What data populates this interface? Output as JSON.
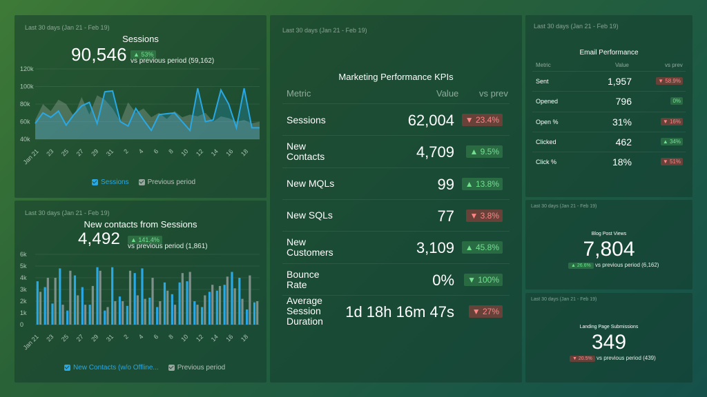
{
  "colors": {
    "accent": "#29a8e6",
    "previous": "#9aa9a0",
    "up": "#6fe08e",
    "down": "#ff8a8a"
  },
  "sessions": {
    "period": "Last 30 days (Jan 21 - Feb 19)",
    "title": "Sessions",
    "value": "90,546",
    "change": "▲ 53%",
    "vs_previous": "vs previous period (59,162)",
    "legend": {
      "current": "Sessions",
      "previous": "Previous period"
    }
  },
  "contacts": {
    "period": "Last 30 days (Jan 21 - Feb 19)",
    "title": "New contacts from Sessions",
    "value": "4,492",
    "change": "▲ 141.4%",
    "vs_previous": "vs previous period (1,861)",
    "legend": {
      "current": "New Contacts (w/o Offline...",
      "previous": "Previous period"
    }
  },
  "kpi": {
    "period": "Last 30 days (Jan 21 - Feb 19)",
    "title": "Marketing Performance KPIs",
    "col_metric": "Metric",
    "col_value": "Value",
    "col_vs": "vs prev",
    "rows": [
      {
        "name": "Sessions",
        "value": "62,004",
        "change": "▼ 23.4%",
        "dir": "dn"
      },
      {
        "name": "New\nContacts",
        "value": "4,709",
        "change": "▲ 9.5%",
        "dir": "up"
      },
      {
        "name": "New MQLs",
        "value": "99",
        "change": "▲ 13.8%",
        "dir": "up"
      },
      {
        "name": "New SQLs",
        "value": "77",
        "change": "▼ 3.8%",
        "dir": "dn"
      },
      {
        "name": "New\nCustomers",
        "value": "3,109",
        "change": "▲ 45.8%",
        "dir": "up"
      },
      {
        "name": "Bounce\nRate",
        "value": "0%",
        "change": "▼ 100%",
        "dir": "up"
      },
      {
        "name": "Average\nSession\nDuration",
        "value": "1d 18h 16m 47s",
        "change": "▼ 27%",
        "dir": "dn"
      }
    ]
  },
  "email": {
    "period": "Last 30 days (Jan 21 - Feb 19)",
    "title": "Email Performance",
    "col_metric": "Metric",
    "col_value": "Value",
    "col_vs": "vs prev",
    "rows": [
      {
        "name": "Sent",
        "value": "1,957",
        "change": "▼ 58.9%",
        "dir": "dn"
      },
      {
        "name": "Opened",
        "value": "796",
        "change": "0%",
        "dir": "up"
      },
      {
        "name": "Open %",
        "value": "31%",
        "change": "▼ 16%",
        "dir": "dn"
      },
      {
        "name": "Clicked",
        "value": "462",
        "change": "▲ 34%",
        "dir": "up"
      },
      {
        "name": "Click %",
        "value": "18%",
        "change": "▼ 51%",
        "dir": "dn"
      }
    ]
  },
  "blog": {
    "period": "Last 30 days (Jan 21 - Feb 19)",
    "title": "Blog Post Views",
    "value": "7,804",
    "change": "▲ 26.6%",
    "vs_previous": "vs previous period (6,162)"
  },
  "landing": {
    "period": "Last 30 days (Jan 21 - Feb 19)",
    "title": "Landing Page Submissions",
    "value": "349",
    "change": "▼ 20.5%",
    "vs_previous": "vs previous period (439)"
  },
  "chart_data": [
    {
      "type": "line",
      "title": "Sessions",
      "x": [
        "Jan 21",
        "22",
        "23",
        "24",
        "25",
        "26",
        "27",
        "28",
        "29",
        "30",
        "31",
        "1",
        "2",
        "3",
        "4",
        "5",
        "6",
        "7",
        "8",
        "9",
        "10",
        "11",
        "12",
        "13",
        "14",
        "15",
        "16",
        "17",
        "18",
        "19"
      ],
      "tick_labels": [
        "Jan 21",
        "23",
        "25",
        "27",
        "29",
        "31",
        "2",
        "4",
        "6",
        "8",
        "10",
        "12",
        "14",
        "16",
        "18"
      ],
      "ylim": [
        40000,
        120000
      ],
      "yticks": [
        "40k",
        "60k",
        "80k",
        "100k",
        "120k"
      ],
      "series": [
        {
          "name": "Sessions",
          "values": [
            58000,
            70000,
            65000,
            72000,
            56000,
            68000,
            78000,
            82000,
            58000,
            94000,
            95000,
            60000,
            55000,
            75000,
            62000,
            50000,
            68000,
            69000,
            70000,
            60000,
            50000,
            98000,
            60000,
            62000,
            96000,
            80000,
            53000,
            98000,
            53000,
            53000
          ]
        },
        {
          "name": "Previous period",
          "values": [
            62000,
            80000,
            72000,
            85000,
            80000,
            66000,
            88000,
            68000,
            90000,
            85000,
            75000,
            60000,
            82000,
            70000,
            75000,
            65000,
            70000,
            63000,
            72000,
            65000,
            68000,
            66000,
            70000,
            60000,
            66000,
            64000,
            60000,
            62000,
            58000,
            60000
          ]
        }
      ],
      "grid": true,
      "legend": "bottom"
    },
    {
      "type": "bar",
      "title": "New contacts from Sessions",
      "x": [
        "Jan 21",
        "22",
        "23",
        "24",
        "25",
        "26",
        "27",
        "28",
        "29",
        "30",
        "31",
        "1",
        "2",
        "3",
        "4",
        "5",
        "6",
        "7",
        "8",
        "9",
        "10",
        "11",
        "12",
        "13",
        "14",
        "15",
        "16",
        "17",
        "18",
        "19"
      ],
      "tick_labels": [
        "Jan 21",
        "23",
        "25",
        "27",
        "29",
        "31",
        "2",
        "4",
        "6",
        "8",
        "10",
        "12",
        "14",
        "16",
        "18"
      ],
      "ylim": [
        0,
        6000
      ],
      "yticks": [
        "0",
        "1k",
        "2k",
        "3k",
        "4k",
        "5k",
        "6k"
      ],
      "series": [
        {
          "name": "New Contacts (w/o Offline...",
          "values": [
            3700,
            3200,
            1800,
            4800,
            1200,
            4200,
            3200,
            1700,
            4900,
            1200,
            4900,
            2400,
            1600,
            4400,
            4800,
            2300,
            1500,
            3600,
            2600,
            3600,
            3700,
            2000,
            1500,
            2800,
            2900,
            3400,
            4500,
            4000,
            1300,
            1900
          ]
        },
        {
          "name": "Previous period",
          "values": [
            2800,
            4000,
            4000,
            1700,
            4600,
            2500,
            1700,
            3300,
            4600,
            1500,
            2000,
            2000,
            4600,
            2500,
            2200,
            4000,
            2000,
            2900,
            1700,
            4400,
            4500,
            1700,
            2500,
            3400,
            3300,
            4100,
            3100,
            2200,
            4200,
            2000
          ]
        }
      ],
      "grid": true,
      "legend": "bottom"
    }
  ]
}
